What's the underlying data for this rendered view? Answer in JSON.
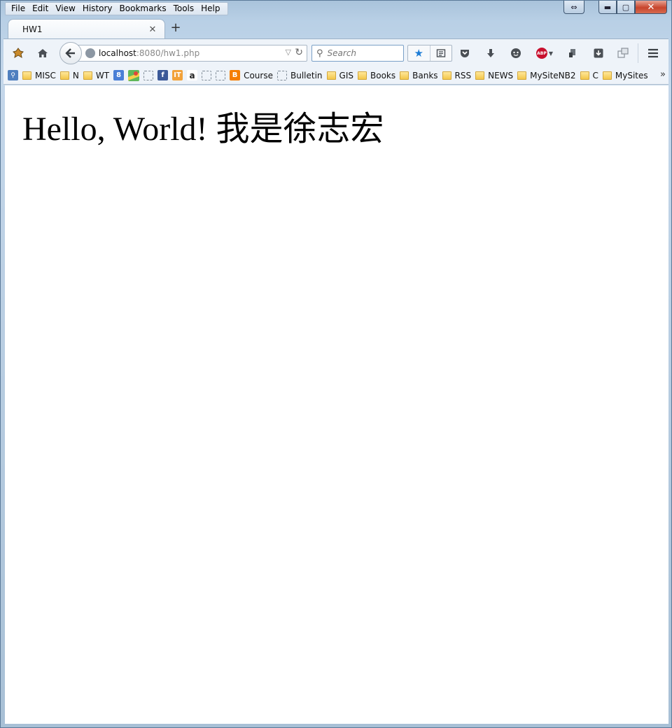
{
  "menu": [
    "File",
    "Edit",
    "View",
    "History",
    "Bookmarks",
    "Tools",
    "Help"
  ],
  "window_controls": {
    "restore_glyph": "⇔",
    "minimize_glyph": "▬",
    "maximize_glyph": "▢",
    "close_glyph": "✕"
  },
  "tab": {
    "title": "HW1",
    "close_glyph": "✕"
  },
  "new_tab_glyph": "+",
  "urlbar": {
    "host": "localhost",
    "rest": ":8080/hw1.php"
  },
  "search": {
    "placeholder": "Search"
  },
  "toolbar_icons": [
    "extension-icon",
    "home-icon",
    "back-icon",
    "bookmark-star-icon",
    "reading-list-icon",
    "pocket-icon",
    "download-icon",
    "chat-icon",
    "adblock-icon",
    "extension-icon",
    "download-box-icon",
    "sync-icon",
    "menu-icon"
  ],
  "bookmarks": [
    {
      "type": "icon",
      "icon": "search-page-icon",
      "label": ""
    },
    {
      "type": "folder",
      "label": "MISC"
    },
    {
      "type": "folder",
      "label": "N"
    },
    {
      "type": "folder",
      "label": "WT"
    },
    {
      "type": "icon",
      "icon": "google-icon",
      "label": ""
    },
    {
      "type": "icon",
      "icon": "maps-icon",
      "label": ""
    },
    {
      "type": "icon",
      "icon": "placeholder-icon",
      "label": ""
    },
    {
      "type": "icon",
      "icon": "facebook-icon",
      "label": ""
    },
    {
      "type": "icon",
      "icon": "it-icon",
      "label": ""
    },
    {
      "type": "icon",
      "icon": "amazon-icon",
      "label": ""
    },
    {
      "type": "icon",
      "icon": "placeholder-icon",
      "label": ""
    },
    {
      "type": "icon",
      "icon": "placeholder-icon",
      "label": ""
    },
    {
      "type": "icon-label",
      "icon": "blogger-icon",
      "label": "Course"
    },
    {
      "type": "icon-label",
      "icon": "placeholder-icon",
      "label": "Bulletin"
    },
    {
      "type": "folder",
      "label": "GIS"
    },
    {
      "type": "folder",
      "label": "Books"
    },
    {
      "type": "folder",
      "label": "Banks"
    },
    {
      "type": "folder",
      "label": "RSS"
    },
    {
      "type": "folder",
      "label": "NEWS"
    },
    {
      "type": "folder",
      "label": "MySiteNB2"
    },
    {
      "type": "folder",
      "label": "C"
    },
    {
      "type": "folder",
      "label": "MySites"
    }
  ],
  "bookmarks_overflow_glyph": "»",
  "page": {
    "headline": "Hello, World! 我是徐志宏"
  },
  "colors": {
    "star_blue": "#1e7dd6",
    "close_red": "#c7452c",
    "folder_yellow": "#f3c74a"
  }
}
